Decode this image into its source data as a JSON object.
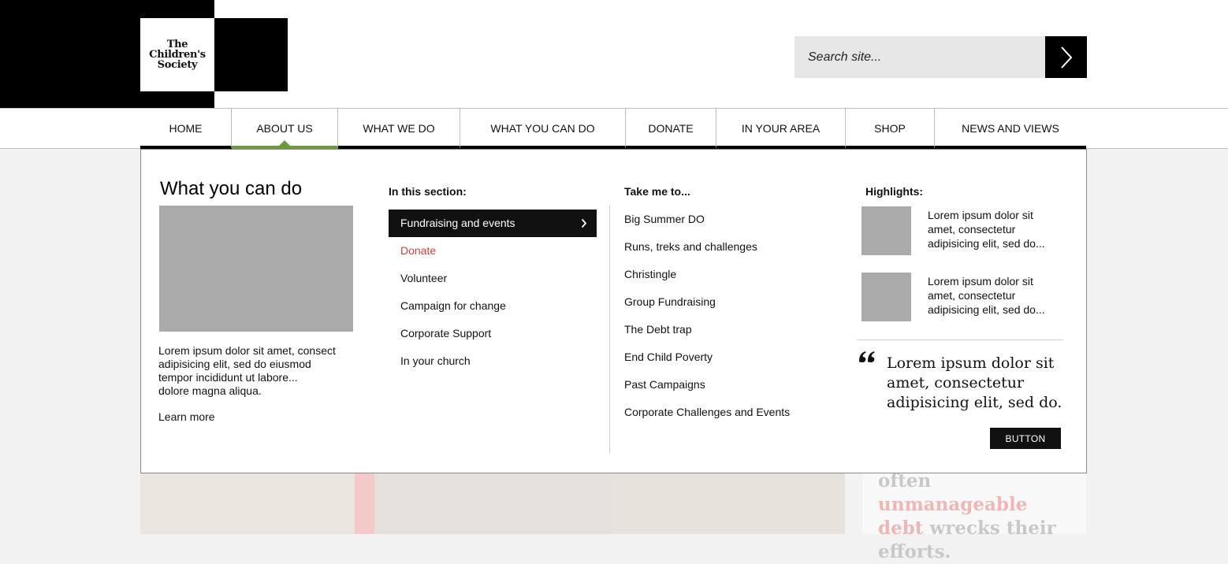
{
  "logo": {
    "lines": [
      "The",
      "Children's",
      "Society"
    ]
  },
  "search": {
    "placeholder": "Search site..."
  },
  "nav": {
    "items": [
      {
        "label": "HOME"
      },
      {
        "label": "ABOUT US",
        "active": true
      },
      {
        "label": "WHAT WE DO"
      },
      {
        "label": "WHAT YOU CAN DO"
      },
      {
        "label": "DONATE"
      },
      {
        "label": "IN YOUR AREA"
      },
      {
        "label": "SHOP"
      },
      {
        "label": "NEWS AND VIEWS"
      }
    ]
  },
  "mega": {
    "title": "What you can do",
    "description_lines": [
      "Lorem ipsum dolor sit amet, consect",
      "adipisicing elit, sed do eiusmod",
      "tempor incididunt ut labore...",
      "dolore magna aliqua."
    ],
    "learn_more": "Learn more",
    "section_heading": "In this section:",
    "section_items": [
      {
        "label": "Fundraising and events",
        "state": "selected"
      },
      {
        "label": "Donate",
        "state": "highlight"
      },
      {
        "label": "Volunteer"
      },
      {
        "label": "Campaign for change"
      },
      {
        "label": "Corporate Support"
      },
      {
        "label": "In your church"
      }
    ],
    "take_heading": "Take me to...",
    "take_items": [
      "Big Summer DO",
      "Runs, treks and challenges",
      "Christingle",
      "Group Fundraising",
      "The Debt trap",
      "End Child Poverty",
      "Past Campaigns",
      "Corporate Challenges and Events"
    ],
    "highlights_heading": "Highlights:",
    "highlights": [
      {
        "lines": [
          "Lorem ipsum dolor sit",
          "amet, consectetur",
          "adipisicing elit, sed do..."
        ]
      },
      {
        "lines": [
          "Lorem ipsum dolor sit",
          "amet, consectetur",
          "adipisicing elit, sed do..."
        ]
      }
    ],
    "quote_lines": [
      "Lorem ipsum dolor sit",
      "amet, consectetur",
      "adipisicing elit, sed do."
    ],
    "button_label": "BUTTON"
  },
  "background_quote": {
    "line1_plain": "often",
    "line1_highlight": "unmanageable",
    "line2_highlight": "debt",
    "line2_plain": "wrecks their",
    "line3_plain": "efforts."
  },
  "colors": {
    "accent_green": "#6a9a3c",
    "highlight_red": "#d93c3c",
    "placeholder_gray": "#aaaaaa"
  }
}
